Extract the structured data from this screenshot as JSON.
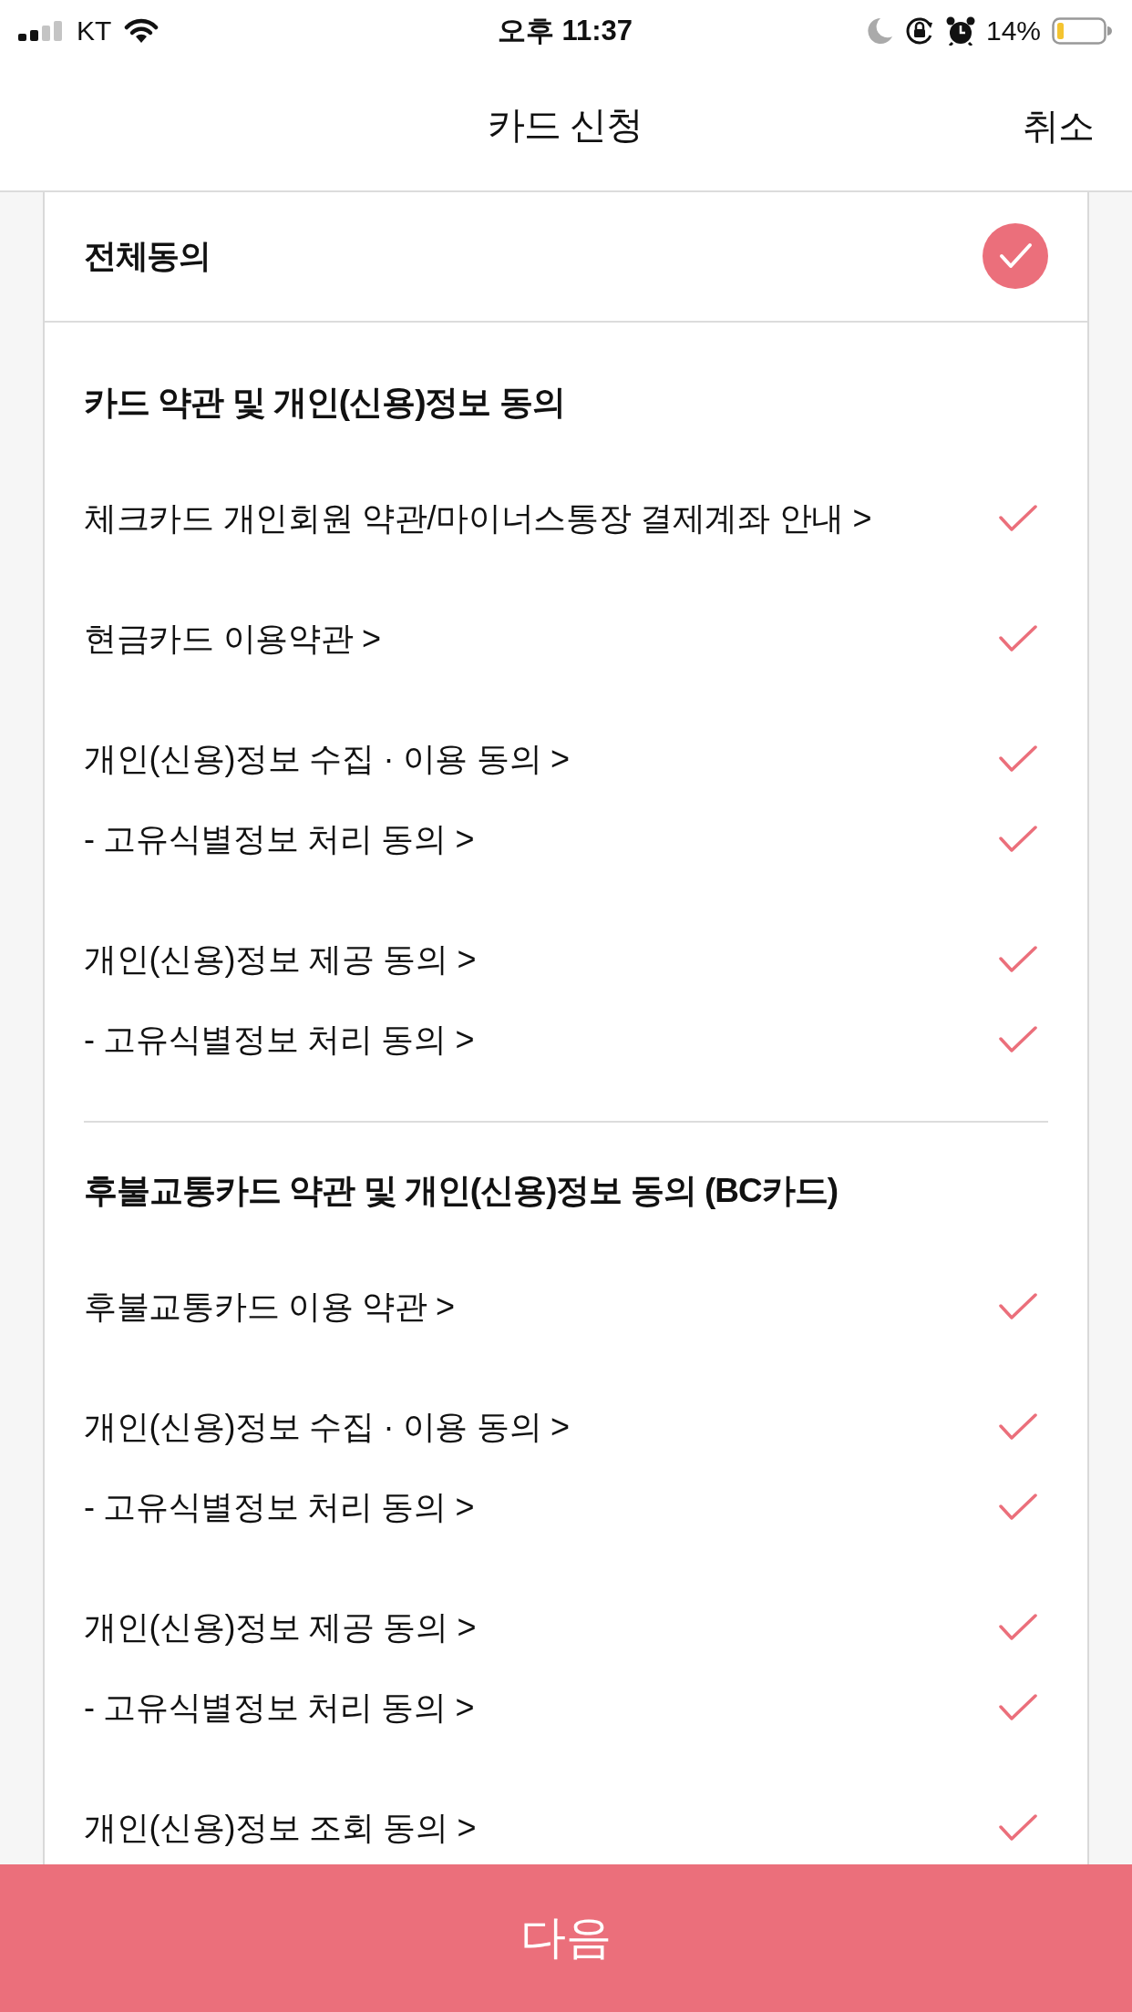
{
  "status_bar": {
    "carrier": "KT",
    "time": "오후 11:37",
    "battery": "14%"
  },
  "header": {
    "title": "카드 신청",
    "cancel": "취소"
  },
  "agree_all": {
    "label": "전체동의",
    "checked": true
  },
  "sections": [
    {
      "title": "카드 약관 및 개인(신용)정보 동의",
      "groups": [
        {
          "items": [
            {
              "label": "체크카드 개인회원 약관/마이너스통장 결제계좌 안내 >",
              "checked": true
            }
          ]
        },
        {
          "items": [
            {
              "label": "현금카드 이용약관 >",
              "checked": true
            }
          ]
        },
        {
          "items": [
            {
              "label": "개인(신용)정보 수집 · 이용 동의 >",
              "checked": true
            },
            {
              "label": "- 고유식별정보 처리 동의 >",
              "checked": true
            }
          ]
        },
        {
          "items": [
            {
              "label": "개인(신용)정보 제공 동의 >",
              "checked": true
            },
            {
              "label": "- 고유식별정보 처리 동의 >",
              "checked": true
            }
          ]
        }
      ]
    },
    {
      "title": "후불교통카드 약관 및 개인(신용)정보 동의 (BC카드)",
      "groups": [
        {
          "items": [
            {
              "label": "후불교통카드 이용 약관 >",
              "checked": true
            }
          ]
        },
        {
          "items": [
            {
              "label": "개인(신용)정보 수집 · 이용 동의 >",
              "checked": true
            },
            {
              "label": "- 고유식별정보 처리 동의 >",
              "checked": true
            }
          ]
        },
        {
          "items": [
            {
              "label": "개인(신용)정보 제공 동의 >",
              "checked": true
            },
            {
              "label": "- 고유식별정보 처리 동의 >",
              "checked": true
            }
          ]
        },
        {
          "items": [
            {
              "label": "개인(신용)정보 조회 동의 >",
              "checked": true
            }
          ]
        }
      ]
    }
  ],
  "next_button": "다음"
}
